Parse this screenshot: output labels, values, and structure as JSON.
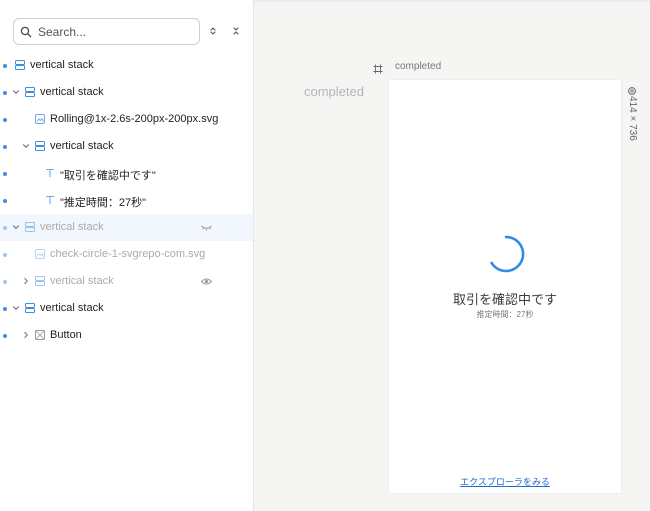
{
  "search": {
    "placeholder": "Search..."
  },
  "layers": [
    {
      "label": "vertical stack",
      "icon": "stack-icon",
      "expanded": false,
      "has_chevron": false,
      "depth": 0,
      "hidden": false,
      "selected": false
    },
    {
      "label": "vertical stack",
      "icon": "stack-icon",
      "expanded": true,
      "has_chevron": true,
      "depth": 0,
      "hidden": false,
      "selected": false
    },
    {
      "label": "Rolling@1x-2.6s-200px-200px.svg",
      "icon": "image-icon",
      "has_chevron": false,
      "depth": 1,
      "hidden": false,
      "selected": false
    },
    {
      "label": "vertical stack",
      "icon": "stack-icon",
      "expanded": true,
      "has_chevron": true,
      "depth": 1,
      "hidden": false,
      "selected": false
    },
    {
      "label": "\"取引を確認中です\"",
      "icon": "text-icon",
      "has_chevron": false,
      "depth": 2,
      "hidden": false,
      "selected": false
    },
    {
      "label": "\"推定時間：27秒\"",
      "icon": "text-icon",
      "has_chevron": false,
      "depth": 2,
      "hidden": false,
      "selected": false
    },
    {
      "label": "vertical stack",
      "icon": "stack-icon",
      "expanded": true,
      "has_chevron": true,
      "depth": 0,
      "hidden": true,
      "selected": true,
      "visibility_icon": "eye-closed-icon"
    },
    {
      "label": "check-circle-1-svgrepo-com.svg",
      "icon": "image-icon",
      "has_chevron": false,
      "depth": 1,
      "hidden": true,
      "selected": false
    },
    {
      "label": "vertical stack",
      "icon": "stack-icon",
      "expanded": false,
      "has_chevron": true,
      "depth": 1,
      "hidden": true,
      "selected": false,
      "visibility_icon": "eye-icon"
    },
    {
      "label": "vertical stack",
      "icon": "stack-icon",
      "expanded": true,
      "has_chevron": true,
      "depth": 0,
      "hidden": false,
      "selected": false
    },
    {
      "label": "Button",
      "icon": "component-icon",
      "expanded": false,
      "has_chevron": true,
      "depth": 1,
      "hidden": false,
      "selected": false
    }
  ],
  "canvas": {
    "frame_name": "completed",
    "ghost_label": "completed",
    "dimensions": "414 × 736",
    "screen": {
      "title": "取引を確認中です",
      "subtitle": "推定時間：27秒",
      "link": "エクスプローラをみる"
    }
  },
  "colors": {
    "accent": "#3b8fe0",
    "spinner": "#2f8ce6",
    "link": "#1b6ad0",
    "selected_row": "#f1f7fd"
  }
}
